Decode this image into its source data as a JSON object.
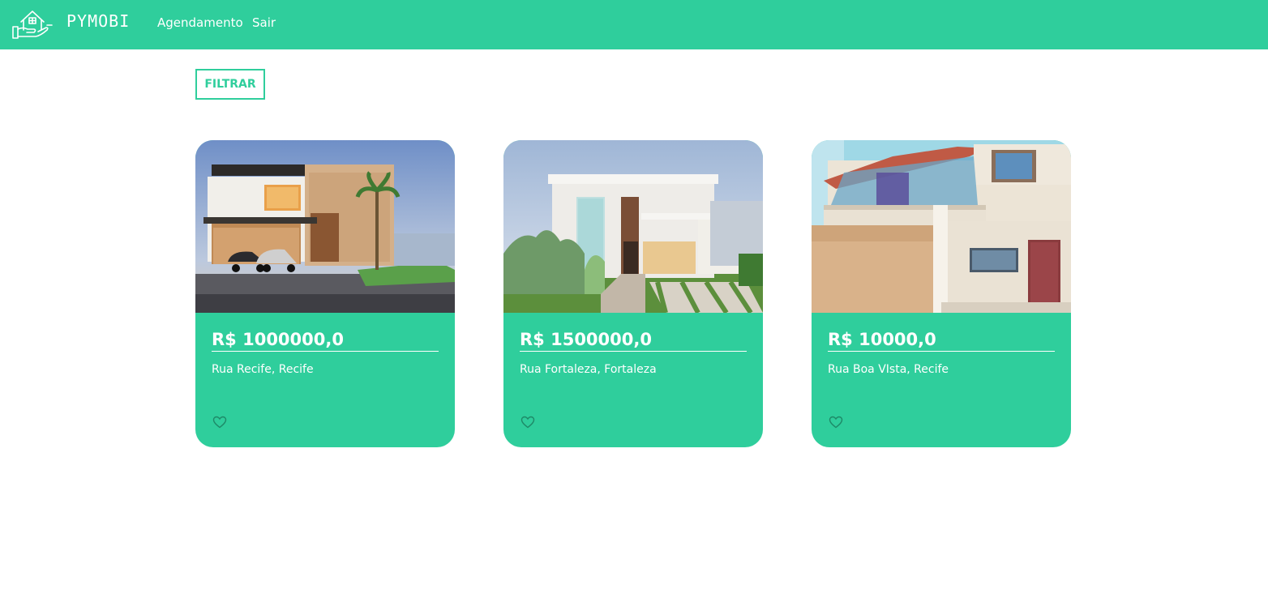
{
  "navbar": {
    "logo_icon": "house-in-hand-icon",
    "brand": "PYMOBI",
    "links": [
      "Agendamento",
      "Sair"
    ],
    "background_color": "#2fce9c"
  },
  "filter": {
    "label": "FILTRAR"
  },
  "listings": [
    {
      "price": "R$ 1000000,0",
      "address": "Rua Recife, Recife",
      "image": "modern-house-photo",
      "favorite_icon": "heart-outline-icon"
    },
    {
      "price": "R$ 1500000,0",
      "address": "Rua Fortaleza, Fortaleza",
      "image": "white-modern-house-photo",
      "favorite_icon": "heart-outline-icon"
    },
    {
      "price": "R$ 10000,0",
      "address": "Rua Boa VIsta, Recife",
      "image": "townhouse-with-glass-balcony-photo",
      "favorite_icon": "heart-outline-icon"
    }
  ],
  "colors": {
    "accent": "#2fce9c",
    "text_on_accent": "#ffffff",
    "heart": "#1e8a68"
  }
}
